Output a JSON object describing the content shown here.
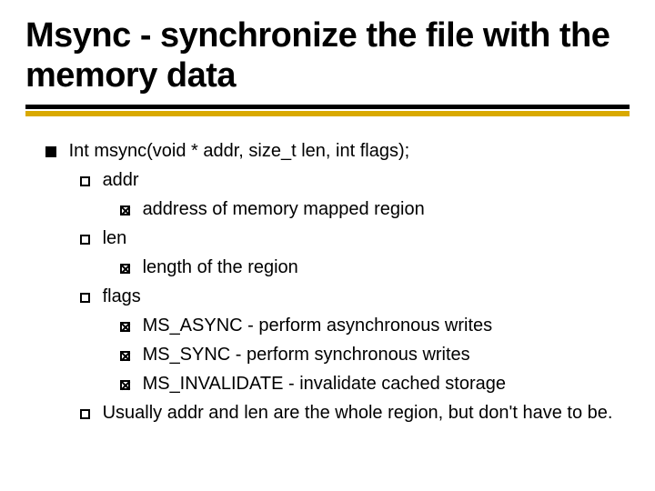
{
  "title": "Msync - synchronize the file with the memory data",
  "lines": [
    {
      "level": 1,
      "text": "Int msync(void * addr, size_t len, int flags);"
    },
    {
      "level": 2,
      "text": "addr"
    },
    {
      "level": 3,
      "text": "address of memory mapped region"
    },
    {
      "level": 2,
      "text": "len"
    },
    {
      "level": 3,
      "text": "length of the region"
    },
    {
      "level": 2,
      "text": "flags"
    },
    {
      "level": 3,
      "text": "MS_ASYNC - perform asynchronous writes"
    },
    {
      "level": 3,
      "text": "MS_SYNC - perform synchronous writes"
    },
    {
      "level": 3,
      "text": "MS_INVALIDATE - invalidate cached storage"
    },
    {
      "level": 2,
      "text": "Usually addr and len are the whole region, but don't have to be."
    }
  ]
}
